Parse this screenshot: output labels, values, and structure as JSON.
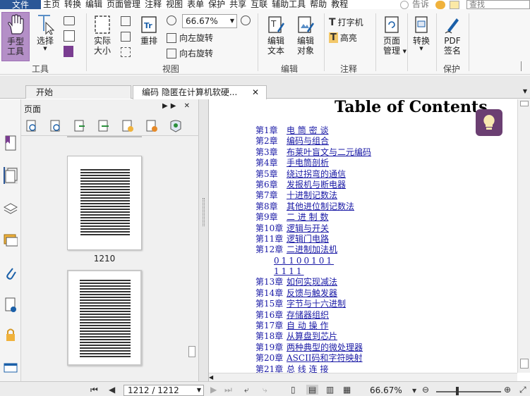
{
  "menubar": {
    "file": "文件",
    "items": [
      "主页",
      "转换",
      "编辑",
      "页面管理",
      "注释",
      "视图",
      "表单",
      "保护",
      "共享",
      "互联",
      "辅助工具",
      "帮助",
      "教程"
    ],
    "tell_me": "告诉",
    "search_placeholder": "查找"
  },
  "ribbon": {
    "hand": "手型\n工具",
    "select": "选择",
    "actual_size": "实际\n大小",
    "reflow": "重排",
    "zoom_value": "66.67%",
    "rotate_left": "向左旋转",
    "rotate_right": "向右旋转",
    "edit_text": "编辑\n文本",
    "edit_object": "编辑\n对象",
    "typewriter": "打字机",
    "highlight": "高亮",
    "page_manage": "页面\n管理",
    "convert": "转换",
    "pdf_sign": "PDF\n签名",
    "groups": {
      "tools": "工具",
      "view": "视图",
      "edit": "编辑",
      "comment": "注释",
      "protect": "保护"
    }
  },
  "tabs": [
    {
      "label": "开始"
    },
    {
      "label": "编码 隐匿在计算机软硬..."
    }
  ],
  "panel": {
    "title": "页面",
    "thumbs": [
      {
        "label": "1210"
      }
    ]
  },
  "document": {
    "title": "Table of Contents",
    "toc": [
      {
        "num": "第1章",
        "title": "电 筒 密 谈"
      },
      {
        "num": "第2章",
        "title": "编码与组合"
      },
      {
        "num": "第3章",
        "title": "布莱叶盲文与二元编码"
      },
      {
        "num": "第4章",
        "title": "手电筒剖析"
      },
      {
        "num": "第5章",
        "title": "绕过拐弯的通信"
      },
      {
        "num": "第6章",
        "title": "发报机与断电器"
      },
      {
        "num": "第7章",
        "title": "十进制记数法"
      },
      {
        "num": "第8章",
        "title": "其他进位制记数法"
      },
      {
        "num": "第9章",
        "title": "二 进 制 数"
      },
      {
        "num": "第10章",
        "title": "逻辑与开关"
      },
      {
        "num": "第11章",
        "title": "逻辑门电路"
      },
      {
        "num": "第12章",
        "title": "二进制加法机"
      },
      {
        "sub": "01100101"
      },
      {
        "sub": "1111"
      },
      {
        "num": "第13章",
        "title": "如何实现减法"
      },
      {
        "num": "第14章",
        "title": "反馈与触发器"
      },
      {
        "num": "第15章",
        "title": "字节与十六进制"
      },
      {
        "num": "第16章",
        "title": "存储器组织"
      },
      {
        "num": "第17章",
        "title": "自 动 操 作"
      },
      {
        "num": "第18章",
        "title": "从算盘到芯片"
      },
      {
        "num": "第19章",
        "title": "两种典型的微处理器"
      },
      {
        "num": "第20章",
        "title": "ASCII码和字符映射"
      },
      {
        "num": "第21章",
        "title": "总 线 连 接"
      }
    ]
  },
  "statusbar": {
    "page": "1212 / 1212",
    "zoom": "66.67%"
  },
  "colors": {
    "accent": "#2b5797",
    "hand_tool_bg": "#b48fc7",
    "tip_bg": "#6b3f72",
    "link": "#1a1aa6"
  }
}
